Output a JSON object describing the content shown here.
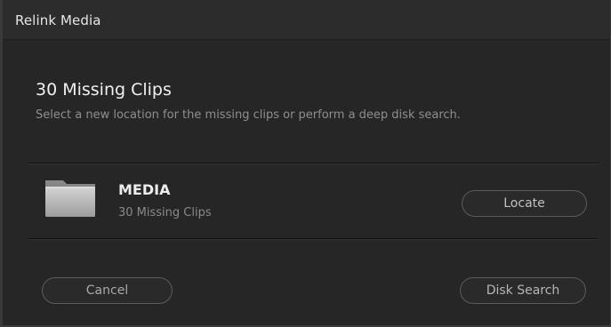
{
  "window": {
    "title": "Relink Media"
  },
  "dialog": {
    "heading": "30 Missing Clips",
    "description": "Select a new location for the missing clips or perform a deep disk search."
  },
  "folder_entry": {
    "icon": "folder-icon",
    "name": "MEDIA",
    "count": "30 Missing Clips",
    "locate_label": "Locate"
  },
  "footer": {
    "cancel_label": "Cancel",
    "disk_search_label": "Disk Search"
  },
  "colors": {
    "background": "#262626",
    "titlebar": "#2c2c2d",
    "text_primary": "#f0f0f0",
    "text_secondary": "#8f8f8f",
    "button_border": "#5c5c5c"
  }
}
